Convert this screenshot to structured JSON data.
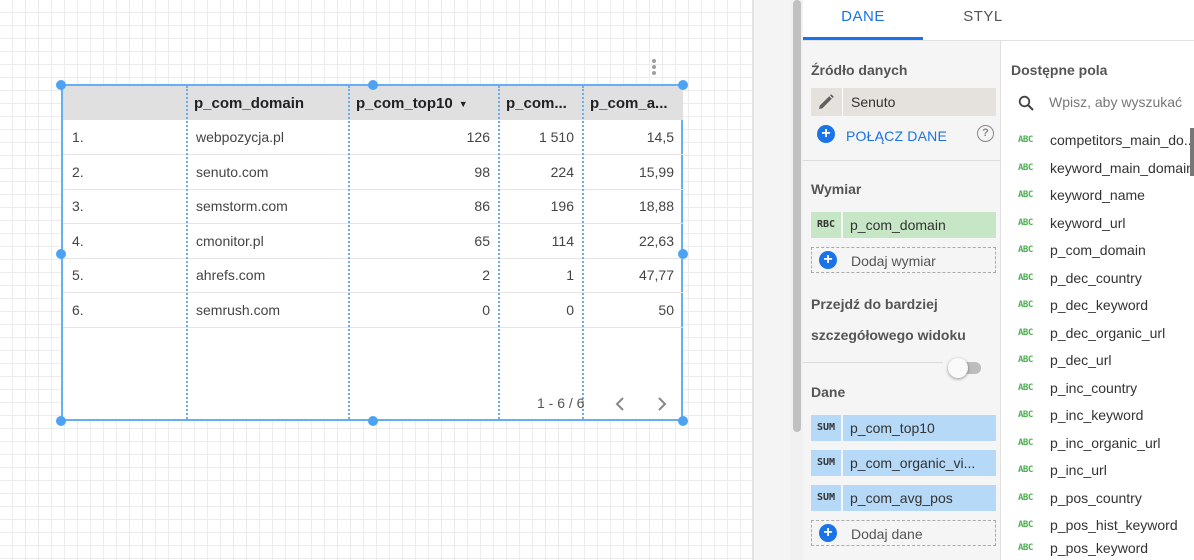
{
  "table": {
    "columns": [
      {
        "label": ""
      },
      {
        "label": "p_com_domain"
      },
      {
        "label": "p_com_top10",
        "sort": "▼"
      },
      {
        "label": "p_com..."
      },
      {
        "label": "p_com_a..."
      }
    ],
    "rows": [
      {
        "idx": "1.",
        "domain": "webpozycja.pl",
        "top10": "126",
        "c3": "1 510",
        "c4": "14,5"
      },
      {
        "idx": "2.",
        "domain": "senuto.com",
        "top10": "98",
        "c3": "224",
        "c4": "15,99"
      },
      {
        "idx": "3.",
        "domain": "semstorm.com",
        "top10": "86",
        "c3": "196",
        "c4": "18,88"
      },
      {
        "idx": "4.",
        "domain": "cmonitor.pl",
        "top10": "65",
        "c3": "114",
        "c4": "22,63"
      },
      {
        "idx": "5.",
        "domain": "ahrefs.com",
        "top10": "2",
        "c3": "1",
        "c4": "47,77"
      },
      {
        "idx": "6.",
        "domain": "semrush.com",
        "top10": "0",
        "c3": "0",
        "c4": "50"
      }
    ],
    "pagination": "1 - 6 / 6"
  },
  "panel": {
    "tabs": [
      {
        "label": "DANE",
        "active": true
      },
      {
        "label": "STYL",
        "active": false
      }
    ],
    "data_source": {
      "title": "Źródło danych",
      "name": "Senuto",
      "connect_label": "POŁĄCZ DANE",
      "help": "?"
    },
    "dimension": {
      "title": "Wymiar",
      "tag": "RBC",
      "field": "p_com_domain",
      "add_label": "Dodaj wymiar"
    },
    "drill": {
      "line1": "Przejdź do bardziej",
      "line2": "szczegółowego widoku",
      "enabled": false
    },
    "metrics": {
      "title": "Dane",
      "items": [
        {
          "tag": "SUM",
          "name": "p_com_top10"
        },
        {
          "tag": "SUM",
          "name": "p_com_organic_vi..."
        },
        {
          "tag": "SUM",
          "name": "p_com_avg_pos"
        }
      ],
      "add_label": "Dodaj dane"
    },
    "available": {
      "title": "Dostępne pola",
      "search_placeholder": "Wpisz, aby wyszukać",
      "type_tag": "ABC",
      "fields": [
        "competitors_main_do...",
        "keyword_main_domain",
        "keyword_name",
        "keyword_url",
        "p_com_domain",
        "p_dec_country",
        "p_dec_keyword",
        "p_dec_organic_url",
        "p_dec_url",
        "p_inc_country",
        "p_inc_keyword",
        "p_inc_organic_url",
        "p_inc_url",
        "p_pos_country",
        "p_pos_hist_keyword",
        "p_pos_keyword"
      ]
    }
  },
  "colors": {
    "accent": "#1a73e8",
    "selection": "#66aff5",
    "dimension_chip": "#c6e6c6",
    "metric_chip": "#b5d9f7",
    "source_chip": "#e5e1dd"
  }
}
